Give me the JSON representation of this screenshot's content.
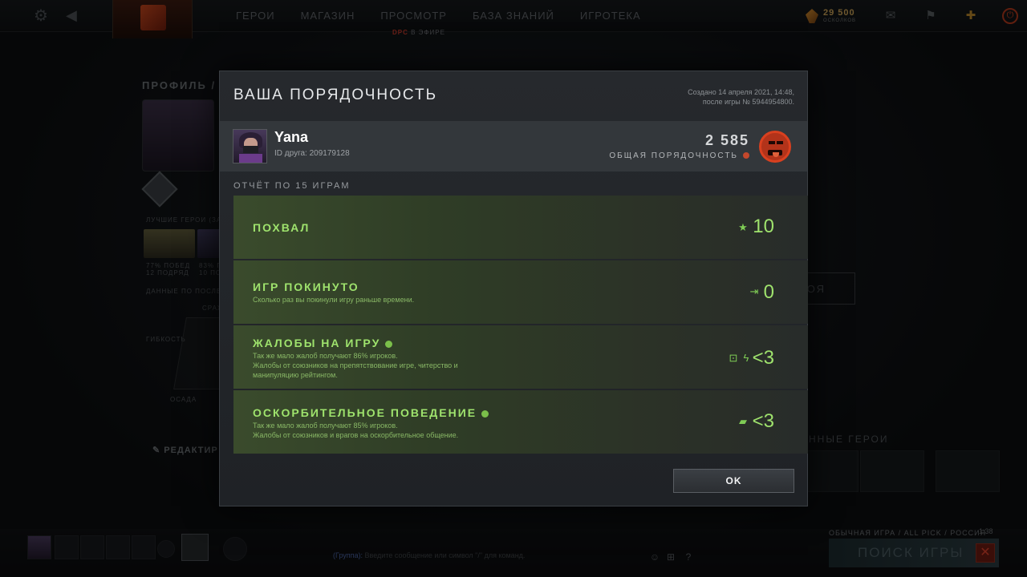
{
  "topbar": {
    "nav": [
      "ГЕРОИ",
      "МАГАЗИН",
      "ПРОСМОТР",
      "БАЗА ЗНАНИЙ",
      "ИГРОТЕКА"
    ],
    "dpc_live": "DPC",
    "dpc_live_suffix": "В ЭФИРЕ",
    "shards_value": "29 500",
    "shards_label": "ОСКОЛКОВ"
  },
  "background": {
    "profile_label": "ПРОФИЛЬ /",
    "best_heroes": "ЛУЧШИЕ ГЕРОИ (ЗА",
    "hero1_stat": "77% ПОБЕД",
    "hero1_sub": "12 ПОДРЯД",
    "hero2_stat": "83% П",
    "hero2_sub": "10 ПОД",
    "recent_data": "ДАННЫЕ ПО ПОСЛЕ",
    "axis_flex": "ГИБКОСТЬ",
    "axis_fight": "СРАЖ",
    "axis_siege": "ОСАДА",
    "edit": "РЕДАКТИР",
    "right_btn": "РОЯ",
    "featured_heroes": "ННЫЕ ГЕРОИ"
  },
  "bottombar": {
    "chat_group": "(Группа):",
    "chat_hint": "Введите сообщение или символ \"/\" для команд.",
    "mm_mode": "ОБЫЧНАЯ ИГРА / ALL PICK / РОССИЯ",
    "mm_time": "1:38",
    "mm_search": "ПОИСК ИГРЫ",
    "mm_cancel": "✕"
  },
  "modal": {
    "title": "ВАША ПОРЯДОЧНОСТЬ",
    "created_line1": "Создано 14 апреля 2021, 14:48,",
    "created_line2": "после игры № 5944954800.",
    "user": {
      "name": "Yana",
      "friend_id": "ID друга: 209179128"
    },
    "score": {
      "value": "2 585",
      "label": "ОБЩАЯ ПОРЯДОЧНОСТЬ"
    },
    "report_title": "ОТЧЁТ ПО 15 ИГРАМ",
    "stats": [
      {
        "name": "ПОХВАЛ",
        "desc": "",
        "value": "10",
        "icon": "star-icon"
      },
      {
        "name": "ИГР ПОКИНУТО",
        "desc": "Сколько раз вы покинули игру раньше времени.",
        "value": "0",
        "icon": "exit-door-icon"
      },
      {
        "name": "ЖАЛОБЫ НА ИГРУ",
        "desc": "Так же мало жалоб получают 86% игроков.",
        "desc2": "Жалобы от союзников на препятствование игре, читерство и манипуляцию рейтингом.",
        "value": "<3",
        "icon": "lock-bolt-icon"
      },
      {
        "name": "ОСКОРБИТЕЛЬНОЕ ПОВЕДЕНИЕ",
        "desc": "Так же мало жалоб получают 85% игроков.",
        "desc2": "Жалобы от союзников и врагов на оскорбительное общение.",
        "value": "<3",
        "icon": "chat-bubble-icon"
      }
    ],
    "ok_label": "OK"
  }
}
